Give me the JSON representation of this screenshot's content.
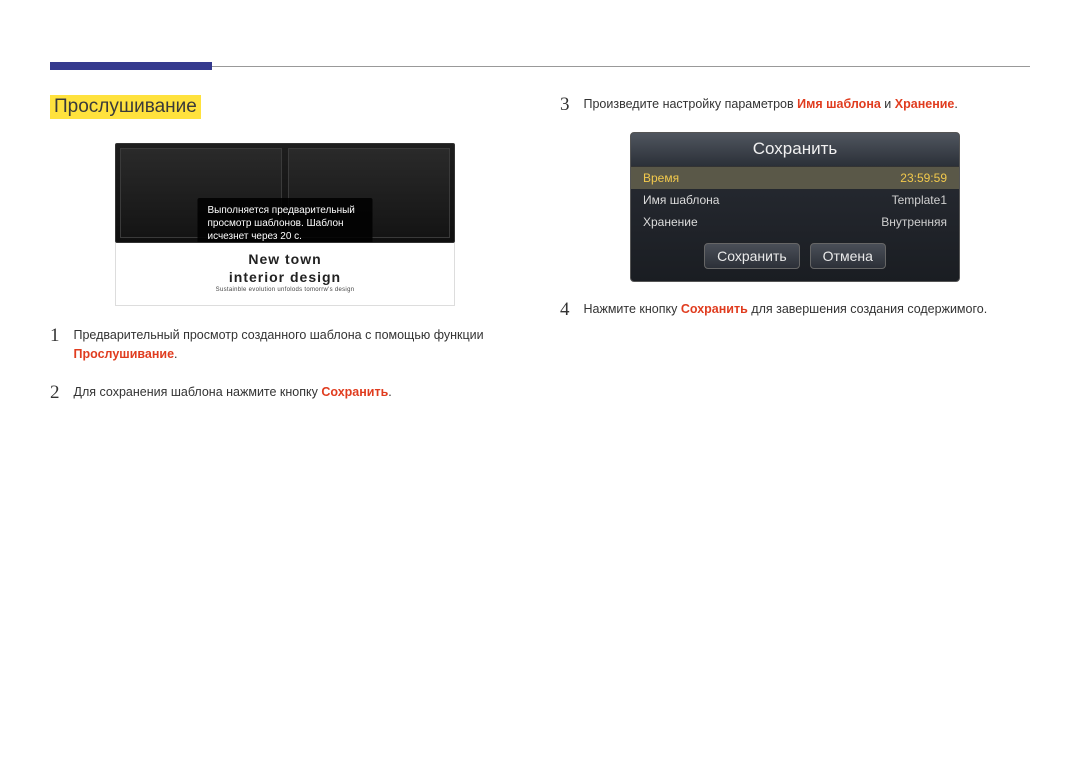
{
  "header": {
    "title": "Прослушивание"
  },
  "previewFigure": {
    "message": "Выполняется предварительный просмотр шаблонов. Шаблон исчезнет через 20 с.",
    "titleLine1": "New town",
    "titleLine2": "interior design",
    "subtitle": "Sustainble evolution unfolods tomorrw's design"
  },
  "leftSteps": {
    "s1": {
      "num": "1",
      "text": "Предварительный просмотр созданного шаблона с помощью функции ",
      "kw": "Прослушивание",
      "tail": "."
    },
    "s2": {
      "num": "2",
      "text": "Для сохранения шаблона нажмите кнопку ",
      "kw": "Сохранить",
      "tail": "."
    }
  },
  "rightSteps": {
    "s3": {
      "num": "3",
      "textA": "Произведите настройку параметров ",
      "kw1": "Имя шаблона",
      "mid": " и ",
      "kw2": "Хранение",
      "tail": "."
    },
    "s4": {
      "num": "4",
      "textA": "Нажмите кнопку ",
      "kw": "Сохранить",
      "tail": " для завершения создания содержимого."
    }
  },
  "dialog": {
    "title": "Сохранить",
    "rows": {
      "time": {
        "label": "Время",
        "value": "23:59:59"
      },
      "name": {
        "label": "Имя шаблона",
        "value": "Template1"
      },
      "store": {
        "label": "Хранение",
        "value": "Внутренняя"
      }
    },
    "buttons": {
      "save": "Сохранить",
      "cancel": "Отмена"
    }
  }
}
